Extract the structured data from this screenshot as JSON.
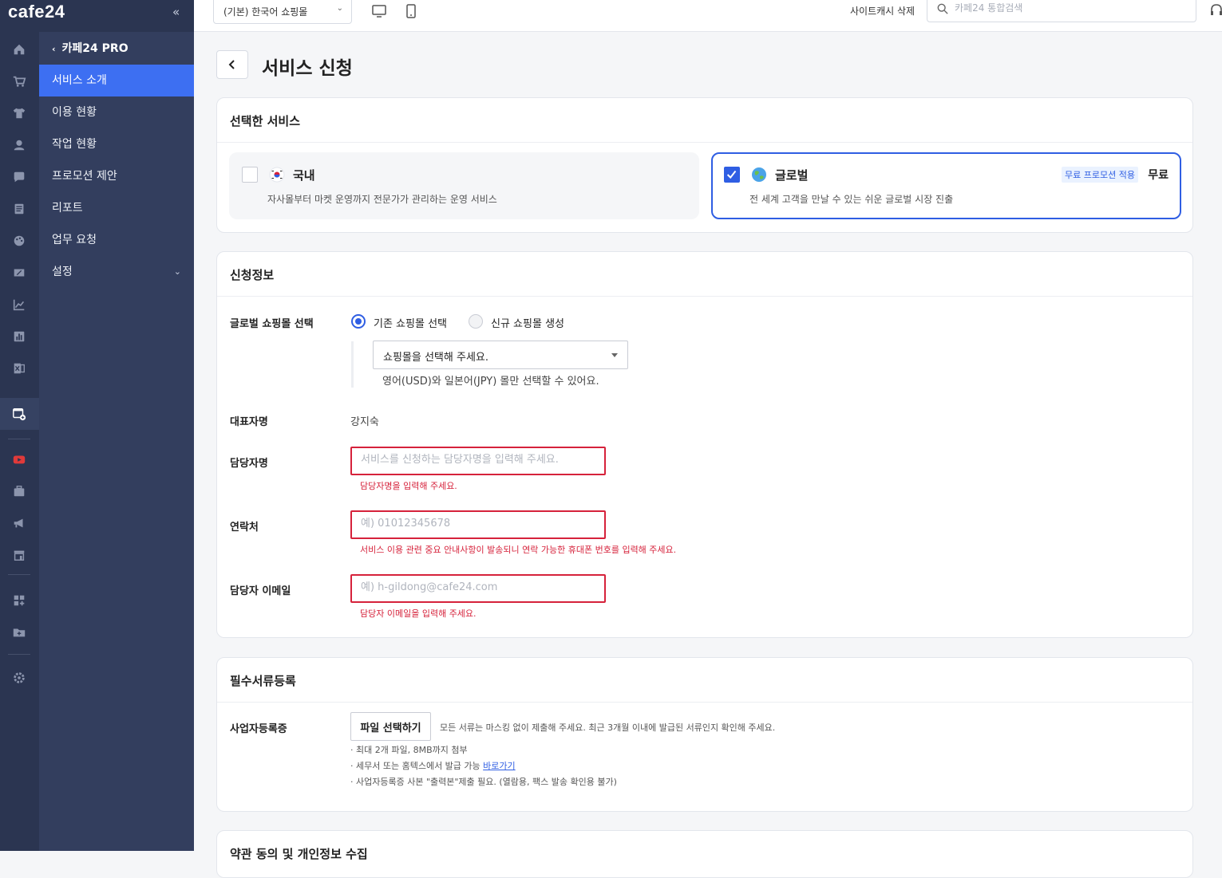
{
  "brand": {
    "logo": "cafe24",
    "collapse_icon": "double-chevron-left-icon",
    "accent": "#3d6ff2",
    "error": "#d6223b"
  },
  "side_menu": {
    "back_label": "카페24 PRO",
    "items": [
      {
        "label": "서비스 소개",
        "active": true
      },
      {
        "label": "이용 현황"
      },
      {
        "label": "작업 현황"
      },
      {
        "label": "프로모션 제안"
      },
      {
        "label": "리포트"
      },
      {
        "label": "업무 요청"
      },
      {
        "label": "설정",
        "has_children": true
      }
    ]
  },
  "topbar": {
    "mall_select": "(기본) 한국어 쇼핑몰",
    "cache_delete": "사이트캐시 삭제",
    "search_placeholder": "카페24 통합검색"
  },
  "page": {
    "title": "서비스 신청"
  },
  "selected_service": {
    "title": "선택한 서비스",
    "options": [
      {
        "name": "국내",
        "desc": "자사몰부터 마켓 운영까지 전문가가 관리하는 운영 서비스",
        "checked": false
      },
      {
        "name": "글로벌",
        "desc": "전 세계 고객을 만날 수 있는 쉬운 글로벌 시장 진출",
        "checked": true,
        "promo": "무료 프로모션 적용",
        "price": "무료"
      }
    ]
  },
  "application_info": {
    "title": "신청정보",
    "global_mall": {
      "label": "글로벌 쇼핑몰 선택",
      "radio_existing": "기존 쇼핑몰 선택",
      "radio_new": "신규 쇼핑몰 생성",
      "select_value": "쇼핑몰을 선택해 주세요.",
      "note": "영어(USD)와 일본어(JPY) 몰만 선택할 수 있어요."
    },
    "representative": {
      "label": "대표자명",
      "value": "강지숙"
    },
    "manager": {
      "label": "담당자명",
      "placeholder": "서비스를 신청하는 담당자명을 입력해 주세요.",
      "error": "담당자명을 입력해 주세요."
    },
    "contact": {
      "label": "연락처",
      "placeholder": "예) 01012345678",
      "error": "서비스 이용 관련 중요 안내사항이 발송되니 연락 가능한 휴대폰 번호를 입력해 주세요."
    },
    "email": {
      "label": "담당자 이메일",
      "placeholder": "예) h-gildong@cafe24.com",
      "error": "담당자 이메일을 입력해 주세요."
    }
  },
  "documents": {
    "title": "필수서류등록",
    "label": "사업자등록증",
    "file_button": "파일 선택하기",
    "note": "모든 서류는 마스킹 없이 제출해 주세요. 최근 3개월 이내에 발급된 서류인지 확인해 주세요.",
    "bullets": [
      "· 최대 2개 파일, 8MB까지 첨부",
      "· 세무서 또는 홈텍스에서 발급 가능",
      "· 사업자등록증 사본 \"출력본\"제출 필요. (열람용, 팩스 발송 확인용 불가)"
    ],
    "link": "바로가기"
  },
  "next_section": {
    "title": "약관 동의 및 개인정보 수집"
  }
}
